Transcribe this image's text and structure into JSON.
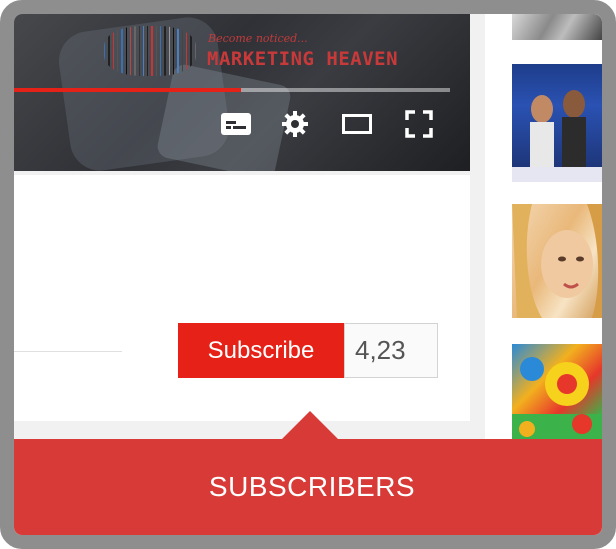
{
  "video": {
    "logo_tagline": "Become noticed...",
    "logo_text": "MARKETING HEAVEN",
    "progress_fraction": 0.52,
    "controls": [
      "subtitles-icon",
      "settings-gear-icon",
      "theater-mode-icon",
      "fullscreen-icon"
    ]
  },
  "subscribe": {
    "label": "Subscribe",
    "count": "4,23"
  },
  "banner": {
    "label": "SUBSCRIBERS"
  },
  "colors": {
    "subscribe_red": "#e62117",
    "banner_red": "#d83a37",
    "frame_gray": "#8e8e8e"
  }
}
